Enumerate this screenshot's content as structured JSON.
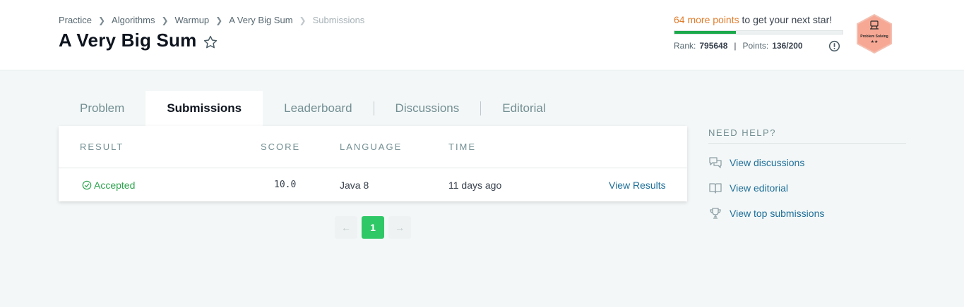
{
  "breadcrumb": [
    "Practice",
    "Algorithms",
    "Warmup",
    "A Very Big Sum",
    "Submissions"
  ],
  "title": "A Very Big Sum",
  "progress": {
    "points_text": "64 more points",
    "suffix_text": "to get your next star!",
    "fraction": 0.3667,
    "rank_label": "Rank:",
    "rank_value": "795648",
    "points_label": "Points:",
    "points_value": "136/200"
  },
  "badge": {
    "label": "Problem Solving",
    "stars": "★★",
    "color": "#f7a894"
  },
  "tabs": [
    {
      "label": "Problem",
      "active": false
    },
    {
      "label": "Submissions",
      "active": true
    },
    {
      "label": "Leaderboard",
      "active": false
    },
    {
      "label": "Discussions",
      "active": false
    },
    {
      "label": "Editorial",
      "active": false
    }
  ],
  "table": {
    "headers": [
      "RESULT",
      "SCORE",
      "LANGUAGE",
      "TIME"
    ],
    "rows": [
      {
        "result": "Accepted",
        "score": "10.0",
        "language": "Java 8",
        "time": "11 days ago",
        "action": "View Results"
      }
    ]
  },
  "pagination": {
    "prev": "←",
    "current": "1",
    "next": "→"
  },
  "help": {
    "title": "NEED HELP?",
    "links": [
      {
        "label": "View discussions",
        "icon": "discussion-icon"
      },
      {
        "label": "View editorial",
        "icon": "book-icon"
      },
      {
        "label": "View top submissions",
        "icon": "trophy-icon"
      }
    ]
  },
  "colors": {
    "accent_green": "#2ec866",
    "link_blue": "#1f6f99",
    "points_orange": "#e07e2e",
    "accepted_green": "#2ea44f"
  }
}
